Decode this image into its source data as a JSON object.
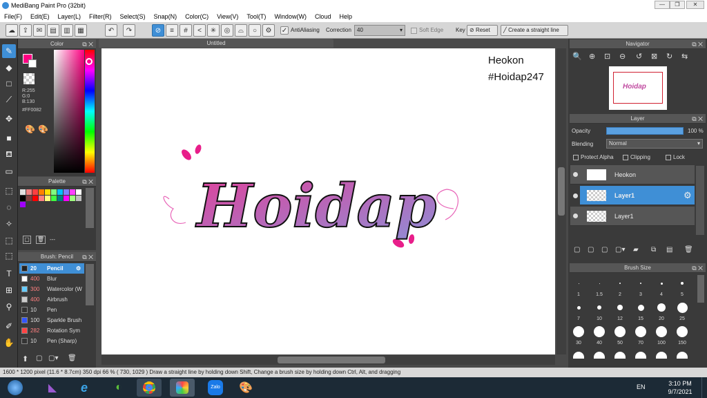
{
  "window": {
    "title": "MediBang Paint Pro (32bit)"
  },
  "menu": [
    "File(F)",
    "Edit(E)",
    "Layer(L)",
    "Filter(R)",
    "Select(S)",
    "Snap(N)",
    "Color(C)",
    "View(V)",
    "Tool(T)",
    "Window(W)",
    "Cloud",
    "Help"
  ],
  "toolbar": {
    "antialias_label": "AntiAliasing",
    "correction_label": "Correction",
    "correction_value": "40",
    "soft_edge_label": "Soft Edge",
    "key_label": "Key",
    "reset_label": "Reset",
    "straight_label": "Create a straight line"
  },
  "document": {
    "tab_title": "Untitled",
    "text_line1": "Heokon",
    "text_line2": "#Hoidap247",
    "art_text": "Hoidap"
  },
  "color_panel": {
    "title": "Color",
    "r": "R:255",
    "g": "G:0",
    "b": "B:130",
    "hex": "#FF0082",
    "primary": "#FF0082"
  },
  "palette": {
    "title": "Palette",
    "footer": "---"
  },
  "brush_panel": {
    "title": "Brush: Pencil",
    "items": [
      {
        "size": "20",
        "name": "Pencil",
        "color": "#222222"
      },
      {
        "size": "400",
        "name": "Blur",
        "color": "#ffffff"
      },
      {
        "size": "300",
        "name": "Watercolor (W",
        "color": "#66ccff"
      },
      {
        "size": "400",
        "name": "Airbrush",
        "color": "#cccccc"
      },
      {
        "size": "10",
        "name": "Pen",
        "color": "#333333"
      },
      {
        "size": "100",
        "name": "Sparkle Brush",
        "color": "#3355ff"
      },
      {
        "size": "282",
        "name": "Rotation Sym",
        "color": "#ff4444"
      },
      {
        "size": "10",
        "name": "Pen (Sharp)",
        "color": "#333333"
      }
    ]
  },
  "navigator": {
    "title": "Navigator"
  },
  "layer_panel": {
    "title": "Layer",
    "opacity_label": "Opacity",
    "opacity_value": "100 %",
    "blending_label": "Blending",
    "blending_value": "Normal",
    "protect_alpha": "Protect Alpha",
    "clipping": "Clipping",
    "lock": "Lock",
    "layers": [
      {
        "name": "Heokon"
      },
      {
        "name": "Layer1"
      },
      {
        "name": "Layer1"
      }
    ]
  },
  "brush_size": {
    "title": "Brush Size",
    "labels_row1": [
      "1",
      "1.5",
      "2",
      "3",
      "4",
      "5"
    ],
    "labels_row2": [
      "7",
      "10",
      "12",
      "15",
      "20",
      "25"
    ],
    "labels_row3": [
      "30",
      "40",
      "50",
      "70",
      "100",
      "150"
    ]
  },
  "status": {
    "text": "1600 * 1200 pixel  (11.6 * 8.7cm)  350 dpi  66 %  ( 730, 1029 )  Draw a straight line by holding down Shift, Change a brush size by holding down Ctrl, Alt, and dragging"
  },
  "taskbar": {
    "lang": "EN",
    "time": "3:10 PM",
    "date": "9/7/2021",
    "zalo": "Zalo"
  }
}
